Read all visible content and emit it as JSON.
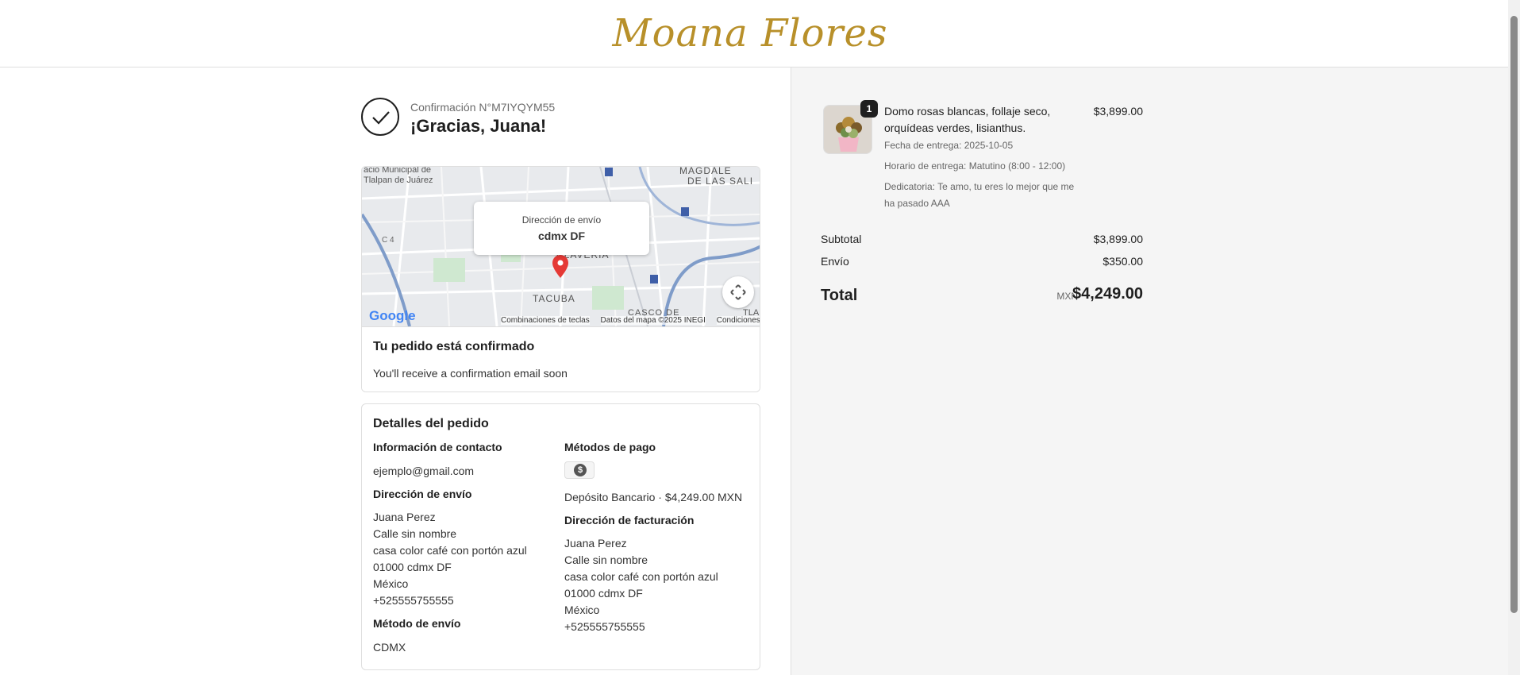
{
  "brand": {
    "name": "Moana Flores"
  },
  "confirmation": {
    "number": "Confirmación N°M7IYQYM55",
    "thanks": "¡Gracias, Juana!"
  },
  "map": {
    "popup_title": "Dirección de envío",
    "popup_value": "cdmx DF",
    "labels": [
      "acio Municipal de",
      "Tlalpan de Juárez",
      "MAGDALE",
      "DE LAS SALI",
      "CLAVERÍA",
      "TACUBA",
      "CASCO DE",
      "TLA",
      "C 4"
    ],
    "footer": [
      "Combinaciones de teclas",
      "Datos del mapa ©2025 INEGI",
      "Condiciones"
    ],
    "google": "Google"
  },
  "status": {
    "title": "Tu pedido está confirmado",
    "subtitle": "You'll receive a confirmation email soon"
  },
  "details": {
    "title": "Detalles del pedido",
    "contact_label": "Información de contacto",
    "contact_value": "ejemplo@gmail.com",
    "shipping_label": "Dirección de envío",
    "shipping_lines": [
      "Juana Perez",
      "Calle sin nombre",
      "casa color café con portón azul",
      "01000 cdmx DF",
      "México",
      "+525555755555"
    ],
    "ship_method_label": "Método de envío",
    "ship_method_value": "CDMX",
    "payment_label": "Métodos de pago",
    "payment_value": "Depósito Bancario · $4,249.00 MXN",
    "billing_label": "Dirección de facturación",
    "billing_lines": [
      "Juana Perez",
      "Calle sin nombre",
      "casa color café con portón azul",
      "01000 cdmx DF",
      "México",
      "+525555755555"
    ]
  },
  "summary": {
    "item": {
      "quantity": "1",
      "name": "Domo rosas blancas, follaje seco, orquídeas verdes, lisianthus.",
      "delivery_date": "Fecha de entrega: 2025-10-05",
      "delivery_time": "Horario de entrega: Matutino (8:00 - 12:00)",
      "dedication": "Dedicatoria: Te amo, tu eres lo mejor que me ha pasado AAA",
      "price": "$3,899.00"
    },
    "subtotal_label": "Subtotal",
    "subtotal_value": "$3,899.00",
    "shipping_label": "Envío",
    "shipping_value": "$350.00",
    "total_label": "Total",
    "total_currency": "MXN",
    "total_value": "$4,249.00"
  },
  "colors": {
    "brand": "#b8902a",
    "pin": "#e53935",
    "panel": "#f5f5f5"
  }
}
